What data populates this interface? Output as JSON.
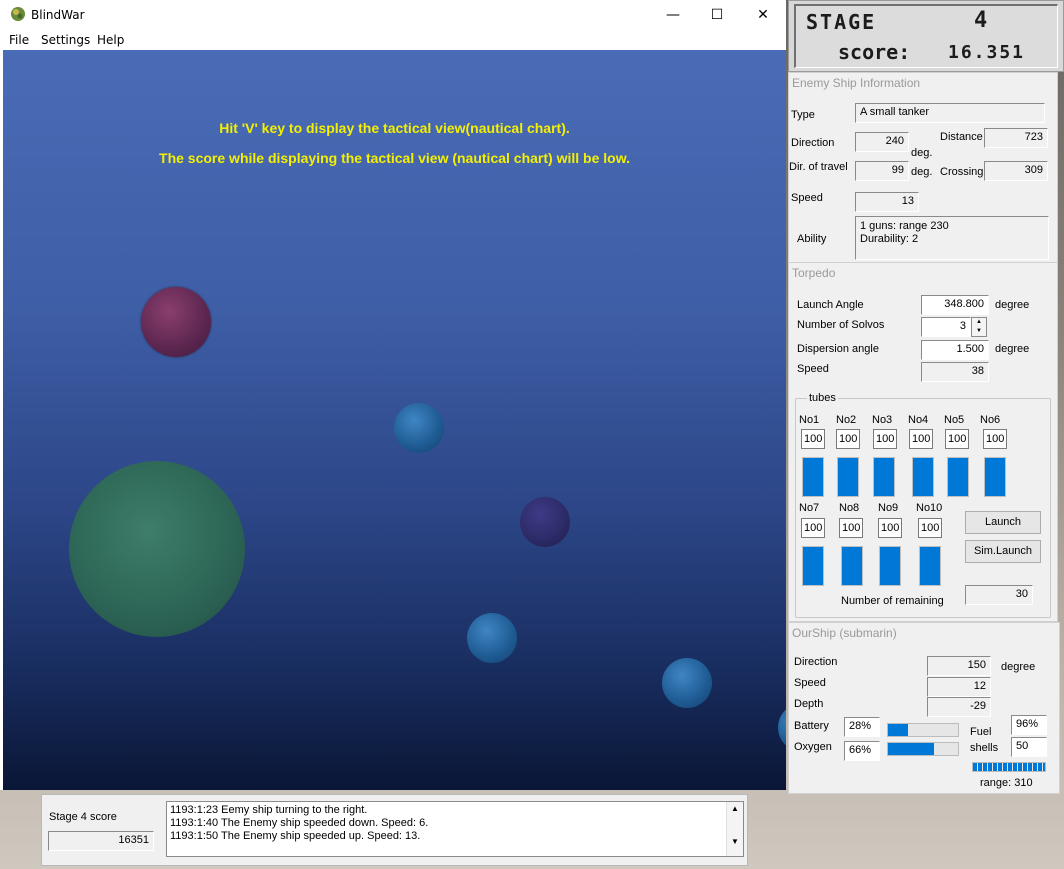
{
  "window": {
    "title": "BlindWar"
  },
  "window_buttons": {
    "minimize": "—",
    "maximize": "☐",
    "close": "✕"
  },
  "menu": [
    "File",
    "Settings",
    "Help"
  ],
  "scene": {
    "hint_line1": "Hit 'V' key to display the tactical view(nautical chart).",
    "hint_line2": "The score while displaying the tactical view (nautical chart) will be low."
  },
  "stage": {
    "label": "STAGE",
    "number": "4",
    "score_label": "score:",
    "score_value": "16.351"
  },
  "enemy": {
    "title": "Enemy Ship Information",
    "type_label": "Type",
    "type_value": "A small tanker",
    "direction_label": "Direction",
    "direction_value": "240",
    "deg_label_1": "deg.",
    "deg_label_2": "deg.",
    "distance_label": "Distance",
    "distance_value": "723",
    "travel_label": "Dir. of travel",
    "travel_value": "99",
    "crossing_label": "Crossing",
    "crossing_value": "309",
    "speed_label": "Speed",
    "speed_value": "13",
    "ability_label": "Ability",
    "ability_line1": "1 guns: range 230",
    "ability_line2": "Durability: 2"
  },
  "torpedo": {
    "title": "Torpedo",
    "launch_angle_label": "Launch Angle",
    "launch_angle_value": "348.800",
    "launch_angle_unit": "degree",
    "solvos_label": "Number of Solvos",
    "solvos_value": "3",
    "dispersion_label": "Dispersion angle",
    "dispersion_value": "1.500",
    "dispersion_unit": "degree",
    "speed_label": "Speed",
    "speed_value": "38",
    "tubes_label": "tubes",
    "tubes": [
      {
        "name": "No1",
        "value": "100"
      },
      {
        "name": "No2",
        "value": "100"
      },
      {
        "name": "No3",
        "value": "100"
      },
      {
        "name": "No4",
        "value": "100"
      },
      {
        "name": "No5",
        "value": "100"
      },
      {
        "name": "No6",
        "value": "100"
      },
      {
        "name": "No7",
        "value": "100"
      },
      {
        "name": "No8",
        "value": "100"
      },
      {
        "name": "No9",
        "value": "100"
      },
      {
        "name": "No10",
        "value": "100"
      }
    ],
    "launch_button": "Launch",
    "sim_launch_button": "Sim.Launch",
    "remaining_label": "Number of remaining",
    "remaining_value": "30"
  },
  "ourship": {
    "title": "OurShip (submarin)",
    "direction_label": "Direction",
    "direction_value": "150",
    "direction_unit": "degree",
    "speed_label": "Speed",
    "speed_value": "12",
    "depth_label": "Depth",
    "depth_value": "-29",
    "battery_label": "Battery",
    "battery_value": "28%",
    "battery_level": 0.28,
    "oxygen_label": "Oxygen",
    "oxygen_value": "66%",
    "oxygen_level": 0.66,
    "fuel_label": "Fuel",
    "fuel_value": "96%",
    "shells_label": "shells",
    "shells_value": "50",
    "range_label": "range: 310"
  },
  "status": {
    "stage_score_label": "Stage 4 score",
    "stage_score_value": "16351",
    "log": [
      "1193:1:23 Eemy ship turning to the right.",
      "1193:1:40 The Enemy ship speeded down.  Speed: 6.",
      "1193:1:50 The Enemy ship speeded up. Speed: 13."
    ]
  },
  "colors": {
    "accent": "#0078d7",
    "hint": "#f4f000",
    "sea_top": "#4a6bb6",
    "sea_bottom": "#0a1636"
  }
}
